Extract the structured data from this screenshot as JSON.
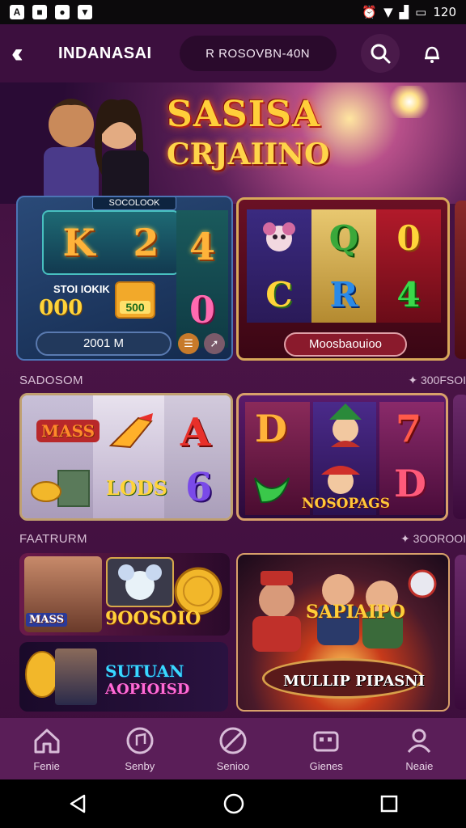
{
  "status_bar": {
    "left_icons": [
      "A",
      "■",
      "●",
      "▼"
    ],
    "right_text": "120"
  },
  "header": {
    "title": "INDANASAI",
    "pill_text": "R ROSOVBN-40N",
    "icons": [
      "back-icon",
      "search-icon",
      "notification-icon"
    ]
  },
  "hero": {
    "logo_line1": "SASISA",
    "logo_line2": "CRJAIINO"
  },
  "featured": {
    "card1": {
      "tag": "SOCOLOOK",
      "symbols": [
        "K",
        "2",
        "4",
        "0"
      ],
      "label": "STOI IOKIK",
      "coins": "000",
      "chip": "500",
      "amount": "2001 M"
    },
    "card2": {
      "symbols": [
        "Q",
        "0",
        "C",
        "R",
        "4"
      ],
      "button": "Moosbaouioo"
    }
  },
  "section1": {
    "title": "SADOSOM",
    "link": "300FSOI",
    "left_card": {
      "symbols": [
        "MASS",
        "A",
        "6"
      ],
      "banner": "LODS"
    },
    "right_card": {
      "symbols": [
        "D",
        "7",
        "D"
      ],
      "banner": "NOSOPAGS"
    }
  },
  "section2": {
    "title": "FAATRURM",
    "link": "3OOROOI",
    "card_a": {
      "banner_small": "MASS",
      "text": "9OOSOIO"
    },
    "card_b": {
      "line1": "SUTUAN",
      "line2": "AOPIOISD"
    },
    "big_card": {
      "title": "SAPIAIPO",
      "caption": "MULLIP PIPASNI"
    }
  },
  "bottom_nav": [
    {
      "label": "Fenie",
      "icon": "home-icon"
    },
    {
      "label": "Senby",
      "icon": "music-icon"
    },
    {
      "label": "Senioo",
      "icon": "compass-icon"
    },
    {
      "label": "Gienes",
      "icon": "games-icon"
    },
    {
      "label": "Neaie",
      "icon": "profile-icon"
    }
  ],
  "colors": {
    "background": "#3a0f3c",
    "accent_gold": "#ffcf3a",
    "nav": "#5a1e58"
  }
}
